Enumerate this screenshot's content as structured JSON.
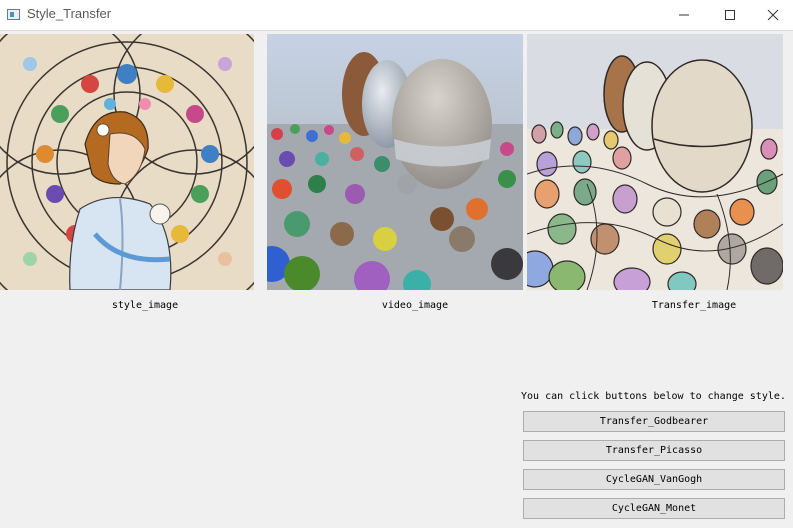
{
  "window": {
    "title": "Style_Transfer"
  },
  "images": {
    "style_caption": "style_image",
    "video_caption": "video_image",
    "transfer_caption": "Transfer_image"
  },
  "controls": {
    "hint": "You can click buttons below to change style.",
    "buttons": [
      {
        "label": "Transfer_Godbearer"
      },
      {
        "label": "Transfer_Picasso"
      },
      {
        "label": "CycleGAN_VanGogh"
      },
      {
        "label": "CycleGAN_Monet"
      }
    ]
  },
  "icons": {
    "app": "app-window-icon",
    "minimize": "minimize-icon",
    "maximize": "maximize-icon",
    "close": "close-icon"
  }
}
